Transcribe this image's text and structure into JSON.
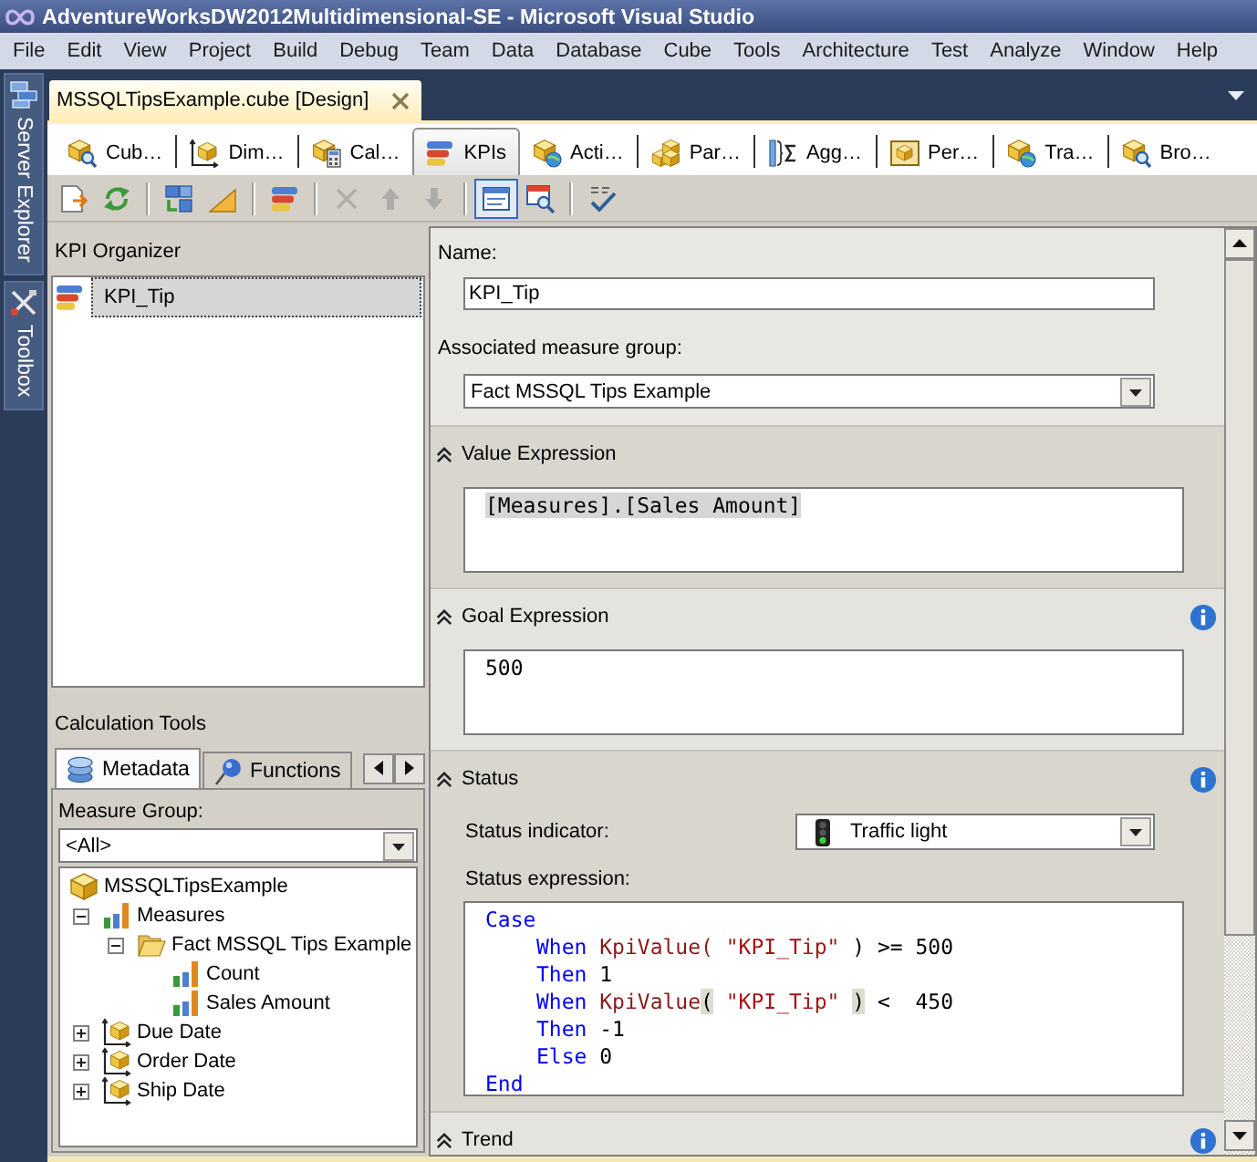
{
  "window": {
    "title": "AdventureWorksDW2012Multidimensional-SE - Microsoft Visual Studio"
  },
  "menu": [
    "File",
    "Edit",
    "View",
    "Project",
    "Build",
    "Debug",
    "Team",
    "Data",
    "Database",
    "Cube",
    "Tools",
    "Architecture",
    "Test",
    "Analyze",
    "Window",
    "Help"
  ],
  "side_tabs": [
    {
      "label": "Server Explorer",
      "kind": "server"
    },
    {
      "label": "Toolbox",
      "kind": "toolbox"
    }
  ],
  "document_tab": {
    "title": "MSSQLTipsExample.cube [Design]"
  },
  "designer_tabs": [
    {
      "label": "Cub…",
      "kind": "cube",
      "selected": false
    },
    {
      "label": "Dim…",
      "kind": "dimension",
      "selected": false
    },
    {
      "label": "Cal…",
      "kind": "calculation",
      "selected": false
    },
    {
      "label": "KPIs",
      "kind": "kpi",
      "selected": true
    },
    {
      "label": "Acti…",
      "kind": "action",
      "selected": false
    },
    {
      "label": "Par…",
      "kind": "partition",
      "selected": false
    },
    {
      "label": "Agg…",
      "kind": "aggregation",
      "selected": false
    },
    {
      "label": "Per…",
      "kind": "perspective",
      "selected": false
    },
    {
      "label": "Tra…",
      "kind": "translation",
      "selected": false
    },
    {
      "label": "Bro…",
      "kind": "browser",
      "selected": false
    }
  ],
  "toolbar": [
    [
      {
        "kind": "new",
        "disabled": false
      },
      {
        "kind": "reconnect",
        "disabled": false
      }
    ],
    [
      {
        "kind": "blocks",
        "disabled": false
      },
      {
        "kind": "ramp",
        "disabled": false
      }
    ],
    [
      {
        "kind": "kpi",
        "disabled": false
      }
    ],
    [
      {
        "kind": "delete",
        "disabled": true
      },
      {
        "kind": "up",
        "disabled": true
      },
      {
        "kind": "down",
        "disabled": true
      }
    ],
    [
      {
        "kind": "form",
        "disabled": false,
        "selected": true
      },
      {
        "kind": "browse",
        "disabled": false,
        "selected": false
      }
    ],
    [
      {
        "kind": "spell",
        "disabled": false
      }
    ]
  ],
  "kpi_organizer": {
    "title": "KPI Organizer",
    "items": [
      {
        "name": "KPI_Tip",
        "selected": true
      }
    ]
  },
  "calculation_tools": {
    "title": "Calculation Tools",
    "tabs": [
      {
        "label": "Metadata",
        "kind": "metadata",
        "selected": true
      },
      {
        "label": "Functions",
        "kind": "functions",
        "selected": false
      }
    ],
    "measure_group_label": "Measure Group:",
    "measure_group": "<All>",
    "tree": [
      {
        "label": "MSSQLTipsExample",
        "kind": "cube",
        "children": [
          {
            "label": "Measures",
            "kind": "measures",
            "expanded": true,
            "children": [
              {
                "label": "Fact MSSQL Tips Example",
                "kind": "measure_group",
                "expanded": true,
                "children": [
                  {
                    "label": "Count",
                    "kind": "measure"
                  },
                  {
                    "label": "Sales Amount",
                    "kind": "measure"
                  }
                ]
              }
            ]
          },
          {
            "label": "Due Date",
            "kind": "dimension",
            "expanded": false
          },
          {
            "label": "Order Date",
            "kind": "dimension",
            "expanded": false
          },
          {
            "label": "Ship Date",
            "kind": "dimension",
            "expanded": false
          }
        ]
      }
    ]
  },
  "kpi_form": {
    "name_label": "Name:",
    "name": "KPI_Tip",
    "group_label": "Associated measure group:",
    "group": "Fact MSSQL Tips Example",
    "sections": [
      {
        "title": "Value Expression",
        "kind": "expression",
        "expanded": true,
        "info": false,
        "code": [
          {
            "indented": false,
            "tokens": [
              {
                "kind": "selection",
                "text": "[Measures].[Sales Amount]"
              }
            ]
          }
        ]
      },
      {
        "title": "Goal Expression",
        "kind": "expression",
        "expanded": true,
        "info": true,
        "code": [
          {
            "indented": false,
            "tokens": [
              {
                "kind": "plain",
                "text": "500"
              }
            ]
          }
        ]
      },
      {
        "title": "Status",
        "kind": "status",
        "expanded": true,
        "info": true,
        "indicator_label": "Status indicator:",
        "indicator": "Traffic light",
        "expression_label": "Status expression:",
        "code": [
          {
            "indented": false,
            "tokens": [
              {
                "kind": "keyword",
                "text": "Case"
              }
            ]
          },
          {
            "indented": true,
            "tokens": [
              {
                "kind": "keyword",
                "text": "When"
              },
              {
                "kind": "function",
                "text": " KpiValue("
              },
              {
                "kind": "string",
                "text": " \"KPI_Tip\""
              },
              {
                "kind": "plain",
                "text": " ) >= 500"
              }
            ]
          },
          {
            "indented": true,
            "tokens": [
              {
                "kind": "keyword",
                "text": "Then"
              },
              {
                "kind": "plain",
                "text": " 1"
              }
            ]
          },
          {
            "indented": true,
            "tokens": [
              {
                "kind": "keyword",
                "text": "When"
              },
              {
                "kind": "function",
                "text": " KpiValue"
              },
              {
                "kind": "brace",
                "text": "("
              },
              {
                "kind": "string",
                "text": " \"KPI_Tip\" "
              },
              {
                "kind": "brace",
                "text": ")"
              },
              {
                "kind": "plain",
                "text": " <  450"
              }
            ]
          },
          {
            "indented": true,
            "tokens": [
              {
                "kind": "keyword",
                "text": "Then"
              },
              {
                "kind": "plain",
                "text": " -1"
              }
            ]
          },
          {
            "indented": true,
            "tokens": [
              {
                "kind": "keyword",
                "text": "Else"
              },
              {
                "kind": "plain",
                "text": " 0"
              }
            ]
          },
          {
            "indented": false,
            "tokens": [
              {
                "kind": "keyword",
                "text": "End"
              }
            ]
          }
        ]
      },
      {
        "title": "Trend",
        "kind": "trend",
        "expanded": true,
        "info": true
      }
    ]
  }
}
